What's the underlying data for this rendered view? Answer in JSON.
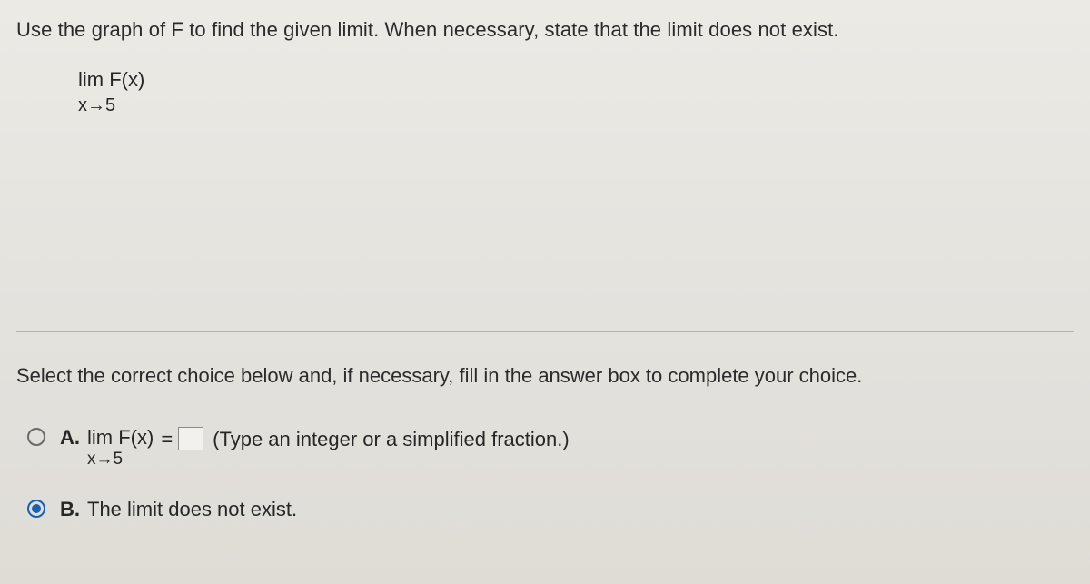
{
  "question": {
    "prompt": "Use the graph of F to find the given limit. When necessary, state that the limit does not exist.",
    "limit_top": "lim F(x)",
    "limit_bottom": "x→5"
  },
  "instruction": "Select the correct choice below and, if necessary, fill in the answer box to complete your choice.",
  "choices": {
    "A": {
      "letter": "A.",
      "expr_top": "lim F(x)",
      "expr_bottom": "x→5",
      "equals": "=",
      "answer_value": "",
      "hint": "(Type an integer or a simplified fraction.)"
    },
    "B": {
      "letter": "B.",
      "text": "The limit does not exist."
    }
  }
}
